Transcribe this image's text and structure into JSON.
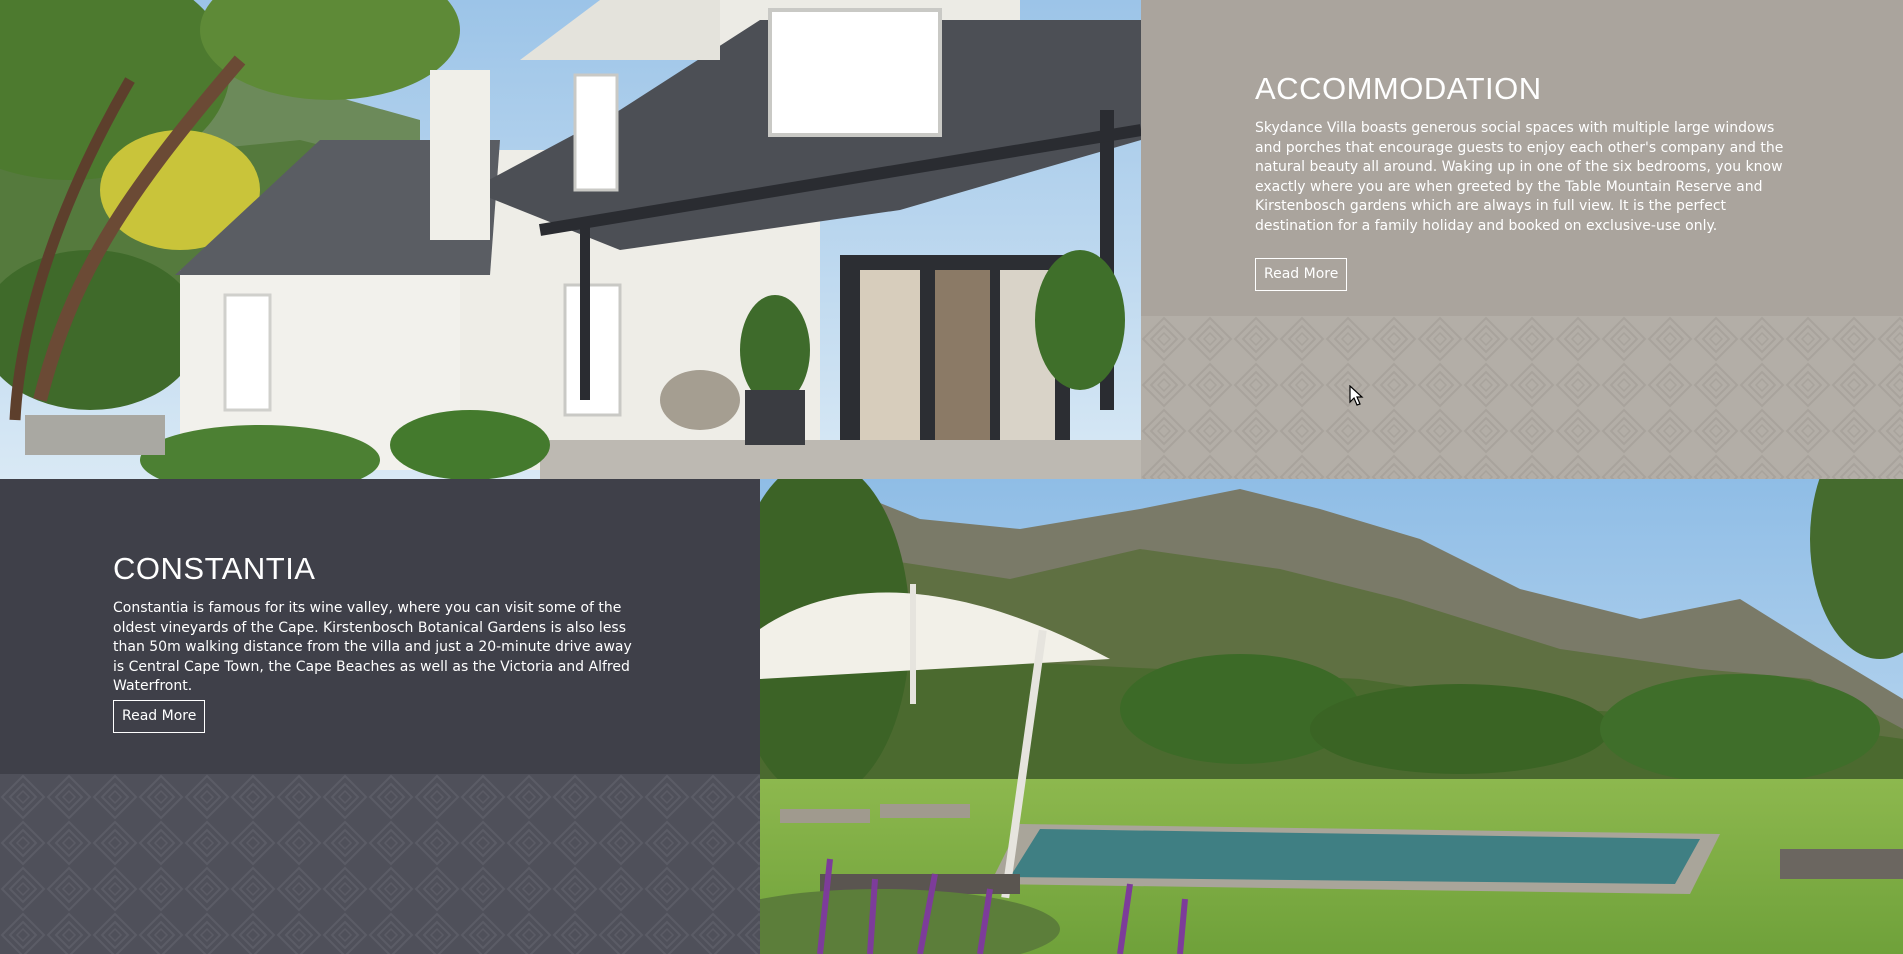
{
  "accommodation": {
    "title": "ACCOMMODATION",
    "description": "Skydance Villa boasts generous social spaces with multiple large windows and porches that encourage guests to enjoy each other's company and the natural beauty all around. Waking up in one of the six bedrooms, you know exactly where you are when greeted by the Table Mountain Reserve and Kirstenbosch gardens which are always in full view. It is the perfect destination for a family holiday and booked on exclusive-use only.",
    "button_label": "Read More"
  },
  "constantia": {
    "title": "CONSTANTIA",
    "description": "Constantia is famous for its wine valley, where you can visit some of the oldest vineyards of the Cape. Kirstenbosch Botanical Gardens is also less than 50m walking distance from the villa and just a 20-minute drive away is Central Cape Town, the Cape Beaches as well as the Victoria and Alfred Waterfront.",
    "button_label": "Read More"
  },
  "colors": {
    "accommodation_panel": "#aaa49d",
    "constantia_panel": "#3f4049",
    "text": "#ffffff"
  },
  "icons": {
    "cursor": "mouse-pointer-icon"
  }
}
